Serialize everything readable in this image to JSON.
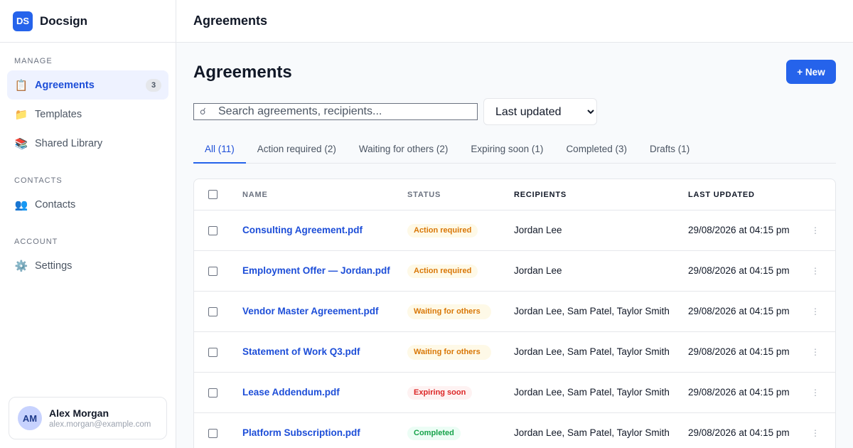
{
  "brand": {
    "logo": "DS",
    "name": "Docsign"
  },
  "sidebar": {
    "sections": [
      {
        "label": "MANAGE"
      },
      {
        "label": "CONTACTS"
      },
      {
        "label": "ACCOUNT"
      }
    ],
    "items": [
      {
        "label": "Agreements",
        "icon": "clipboard-icon",
        "badge": "3"
      },
      {
        "label": "Templates",
        "icon": "folder-icon"
      },
      {
        "label": "Shared Library",
        "icon": "books-icon"
      },
      {
        "label": "Contacts",
        "icon": "people-icon"
      },
      {
        "label": "Settings",
        "icon": "gear-icon"
      }
    ]
  },
  "user": {
    "initials": "AM",
    "name": "Alex Morgan",
    "email": "alex.morgan@example.com"
  },
  "topbar": {
    "title": "Agreements"
  },
  "main": {
    "title": "Agreements",
    "new_button": "+ New",
    "search": {
      "placeholder": "Search agreements, recipients...",
      "value": ""
    },
    "sort": {
      "selected": "Last updated"
    },
    "tabs": [
      {
        "label": "All (11)"
      },
      {
        "label": "Action required (2)"
      },
      {
        "label": "Waiting for others (2)"
      },
      {
        "label": "Expiring soon (1)"
      },
      {
        "label": "Completed (3)"
      },
      {
        "label": "Drafts (1)"
      }
    ]
  },
  "table": {
    "columns": {
      "name": "NAME",
      "status": "STATUS",
      "recipients": "RECIPIENTS",
      "updated": "LAST UPDATED"
    },
    "rows": [
      {
        "name": "Consulting Agreement.pdf",
        "status": "Action required",
        "recipients": "Jordan Lee",
        "updated": "29/08/2026 at 04:15 pm"
      },
      {
        "name": "Employment Offer — Jordan.pdf",
        "status": "Action required",
        "recipients": "Jordan Lee",
        "updated": "29/08/2026 at 04:15 pm"
      },
      {
        "name": "Vendor Master Agreement.pdf",
        "status": "Waiting for others",
        "recipients": "Jordan Lee, Sam Patel, Taylor Smith",
        "updated": "29/08/2026 at 04:15 pm"
      },
      {
        "name": "Statement of Work Q3.pdf",
        "status": "Waiting for others",
        "recipients": "Jordan Lee, Sam Patel, Taylor Smith",
        "updated": "29/08/2026 at 04:15 pm"
      },
      {
        "name": "Lease Addendum.pdf",
        "status": "Expiring soon",
        "recipients": "Jordan Lee, Sam Patel, Taylor Smith",
        "updated": "29/08/2026 at 04:15 pm"
      },
      {
        "name": "Platform Subscription.pdf",
        "status": "Completed",
        "recipients": "Jordan Lee, Sam Patel, Taylor Smith",
        "updated": "29/08/2026 at 04:15 pm"
      }
    ],
    "menu_glyph": "⋮"
  },
  "colors": {
    "accent": "#2563eb",
    "warning": "#d97706",
    "danger": "#dc2626",
    "success": "#16a34a"
  }
}
